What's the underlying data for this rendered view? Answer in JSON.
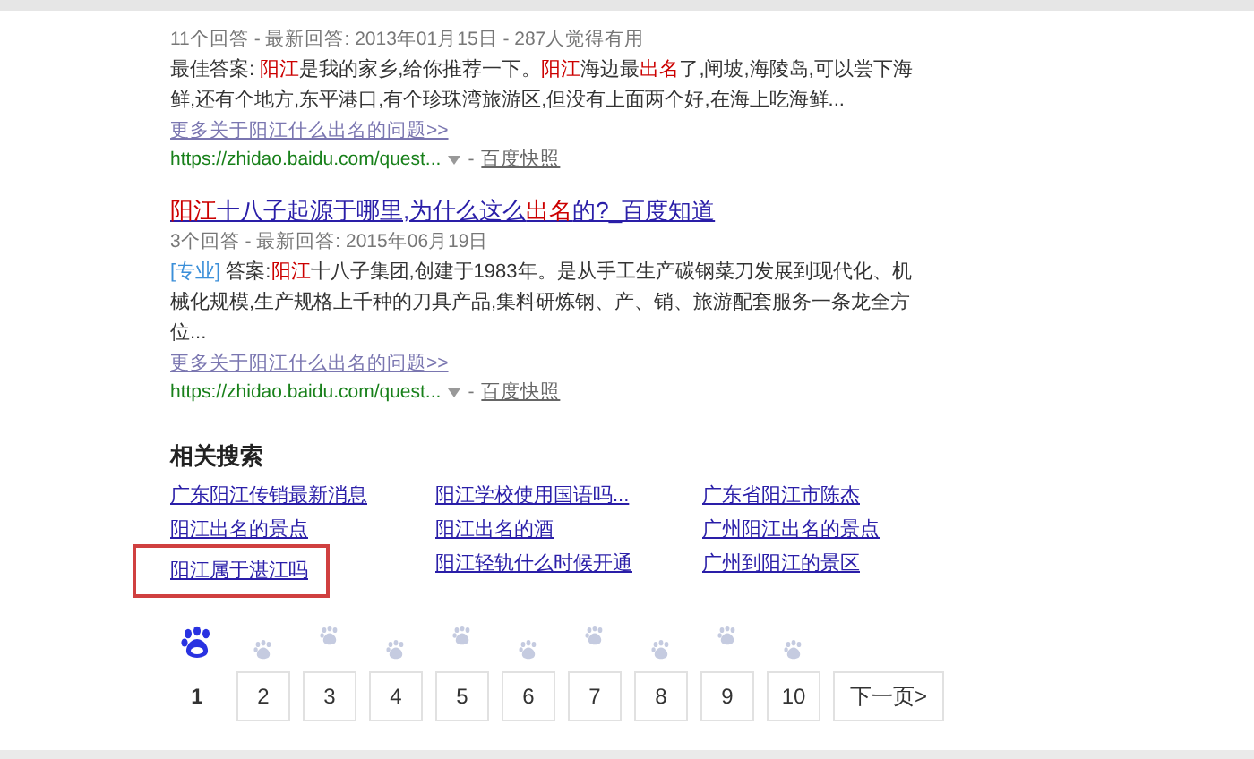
{
  "results": [
    {
      "meta": "11个回答 - 最新回答: 2013年01月15日 - 287人觉得有用",
      "snippet": [
        {
          "kind": "plain",
          "text": "最佳答案: "
        },
        {
          "kind": "highlight",
          "text": "阳江"
        },
        {
          "kind": "plain",
          "text": "是我的家乡,给你推荐一下。"
        },
        {
          "kind": "highlight",
          "text": "阳江"
        },
        {
          "kind": "plain",
          "text": "海边最"
        },
        {
          "kind": "highlight",
          "text": "出名"
        },
        {
          "kind": "plain",
          "text": "了,闸坡,海陵岛,可以尝下海鲜,还有个地方,东平港口,有个珍珠湾旅游区,但没有上面两个好,在海上吃海鲜..."
        }
      ],
      "more": "更多关于阳江什么出名的问题>>",
      "url": "https://zhidao.baidu.com/quest...",
      "separator": "-",
      "snapshot": "百度快照"
    },
    {
      "title": [
        {
          "kind": "highlight",
          "text": "阳江"
        },
        {
          "kind": "plain",
          "text": "十八子起源于哪里,为什么这么"
        },
        {
          "kind": "highlight",
          "text": "出名"
        },
        {
          "kind": "plain",
          "text": "的?_百度知道"
        }
      ],
      "meta": "3个回答 - 最新回答: 2015年06月19日",
      "snippet": [
        {
          "kind": "tag",
          "text": "[专业]"
        },
        {
          "kind": "plain",
          "text": " 答案:"
        },
        {
          "kind": "highlight",
          "text": "阳江"
        },
        {
          "kind": "plain",
          "text": "十八子集团,创建于1983年。是从手工生产碳钢菜刀发展到现代化、机械化规模,生产规格上千种的刀具产品,集料研炼钢、产、销、旅游配套服务一条龙全方位..."
        }
      ],
      "more": "更多关于阳江什么出名的问题>>",
      "url": "https://zhidao.baidu.com/quest...",
      "separator": "-",
      "snapshot": "百度快照"
    }
  ],
  "related": {
    "heading": "相关搜索",
    "items": [
      {
        "text": "广东阳江传销最新消息",
        "boxed": false
      },
      {
        "text": "阳江学校使用国语吗...",
        "boxed": false
      },
      {
        "text": "广东省阳江市陈杰",
        "boxed": false
      },
      {
        "text": "阳江出名的景点",
        "boxed": false
      },
      {
        "text": "阳江出名的酒",
        "boxed": false
      },
      {
        "text": "广州阳江出名的景点",
        "boxed": false
      },
      {
        "text": "阳江属于湛江吗",
        "boxed": true
      },
      {
        "text": "阳江轻轨什么时候开通",
        "boxed": false
      },
      {
        "text": "广州到阳江的景区",
        "boxed": false
      }
    ]
  },
  "pagination": {
    "pages": [
      {
        "label": "1",
        "selected": true
      },
      {
        "label": "2",
        "selected": false
      },
      {
        "label": "3",
        "selected": false
      },
      {
        "label": "4",
        "selected": false
      },
      {
        "label": "5",
        "selected": false
      },
      {
        "label": "6",
        "selected": false
      },
      {
        "label": "7",
        "selected": false
      },
      {
        "label": "8",
        "selected": false
      },
      {
        "label": "9",
        "selected": false
      },
      {
        "label": "10",
        "selected": false
      }
    ],
    "next": "下一页>"
  }
}
